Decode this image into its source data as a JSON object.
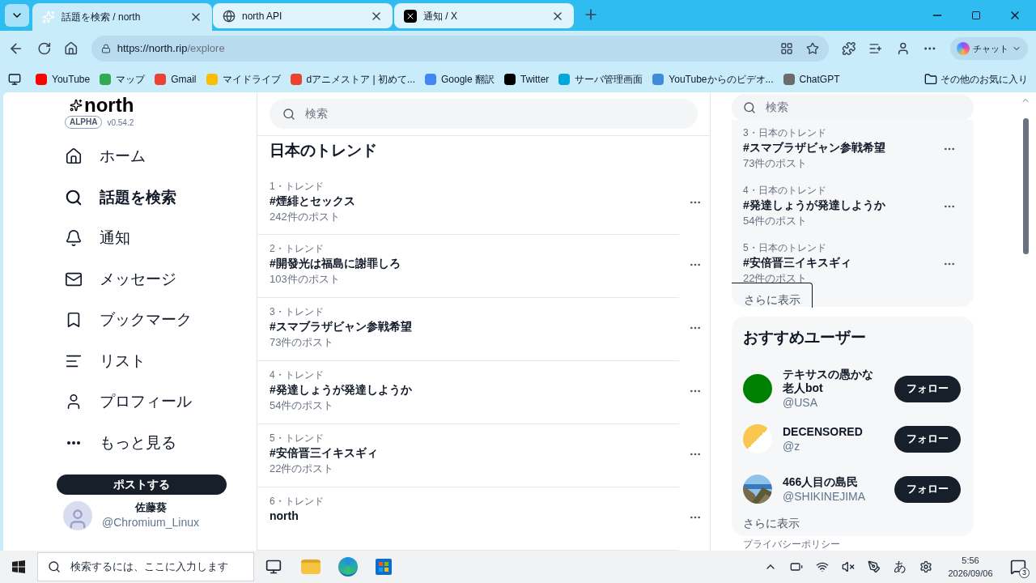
{
  "browser": {
    "tabs": [
      {
        "title": "話題を検索 / north",
        "selected": true,
        "kind": "sparkle"
      },
      {
        "title": "north API",
        "selected": false,
        "kind": "globe"
      },
      {
        "title": "通知 / X",
        "selected": false,
        "kind": "x"
      }
    ],
    "url_host": "https://north.rip",
    "url_path": "/explore",
    "copilot": "チャット",
    "bookmarks": [
      {
        "label": "YouTube",
        "color": "#ff0000"
      },
      {
        "label": "マップ",
        "color": "#34a853"
      },
      {
        "label": "Gmail",
        "color": "#ea4335"
      },
      {
        "label": "マイドライブ",
        "color": "#fbbc04"
      },
      {
        "label": "dアニメストア | 初めて...",
        "color": "#e8452c"
      },
      {
        "label": "Google 翻訳",
        "color": "#4285f4"
      },
      {
        "label": "Twitter",
        "color": "#000000"
      },
      {
        "label": "サーバ管理画面",
        "color": "#00a7d9"
      },
      {
        "label": "YouTubeからのビデオ...",
        "color": "#3d8bd9"
      },
      {
        "label": "ChatGPT",
        "color": "#6b6b6b"
      }
    ],
    "other_bookmarks": "その他のお気に入り"
  },
  "app": {
    "logo": "north",
    "badge": "ALPHA",
    "version": "v0.54.2",
    "nav": [
      {
        "label": "ホーム",
        "kind": "home",
        "selected": false
      },
      {
        "label": "話題を検索",
        "kind": "search",
        "selected": true
      },
      {
        "label": "通知",
        "kind": "bell",
        "selected": false
      },
      {
        "label": "メッセージ",
        "kind": "mail",
        "selected": false
      },
      {
        "label": "ブックマーク",
        "kind": "bookmark",
        "selected": false
      },
      {
        "label": "リスト",
        "kind": "list",
        "selected": false
      },
      {
        "label": "プロフィール",
        "kind": "user",
        "selected": false
      },
      {
        "label": "もっと見る",
        "kind": "more",
        "selected": false
      }
    ],
    "post_button": "ポストする",
    "account": {
      "name": "佐藤葵",
      "handle": "@Chromium_Linux"
    }
  },
  "main": {
    "search_placeholder": "検索",
    "heading": "日本のトレンド",
    "trends": [
      {
        "meta": "1・トレンド",
        "tag": "#煙緋とセックス",
        "posts": "242件のポスト"
      },
      {
        "meta": "2・トレンド",
        "tag": "#開發光は福島に謝罪しろ",
        "posts": "103件のポスト"
      },
      {
        "meta": "3・トレンド",
        "tag": "#スマブラザビャン参戦希望",
        "posts": "73件のポスト"
      },
      {
        "meta": "4・トレンド",
        "tag": "#発達しょうが発達しようか",
        "posts": "54件のポスト"
      },
      {
        "meta": "5・トレンド",
        "tag": "#安倍晋三イキスギィ",
        "posts": "22件のポスト"
      },
      {
        "meta": "6・トレンド",
        "tag": "north"
      }
    ]
  },
  "right": {
    "search_placeholder": "検索",
    "trends": [
      {
        "meta": "3・日本のトレンド",
        "tag": "#スマブラザビャン参戦希望",
        "posts": "73件のポスト"
      },
      {
        "meta": "4・日本のトレンド",
        "tag": "#発達しょうが発達しようか",
        "posts": "54件のポスト"
      },
      {
        "meta": "5・日本のトレンド",
        "tag": "#安倍晋三イキスギィ",
        "posts": "22件のポスト"
      }
    ],
    "show_more": "さらに表示",
    "users_title": "おすすめユーザー",
    "users": [
      {
        "name": "テキサスの愚かな老人bot",
        "handle": "@USA",
        "follow": "フォロー",
        "avatar": {
          "kind": "solid",
          "color": "#008000"
        }
      },
      {
        "name": "DECENSORED",
        "handle": "@z",
        "follow": "フォロー",
        "avatar": {
          "kind": "half",
          "color": "#f9c74f"
        }
      },
      {
        "name": "466人目の島民",
        "handle": "@SHIKINEJIMA",
        "follow": "フォロー"
      }
    ],
    "users_more": "さらに表示",
    "footer_link": "プライバシーポリシー"
  },
  "taskbar": {
    "search_placeholder": "検索するには、ここに入力します",
    "ime": "あ",
    "time": "5:56",
    "date": "2026/09/06",
    "notifications": "3"
  }
}
